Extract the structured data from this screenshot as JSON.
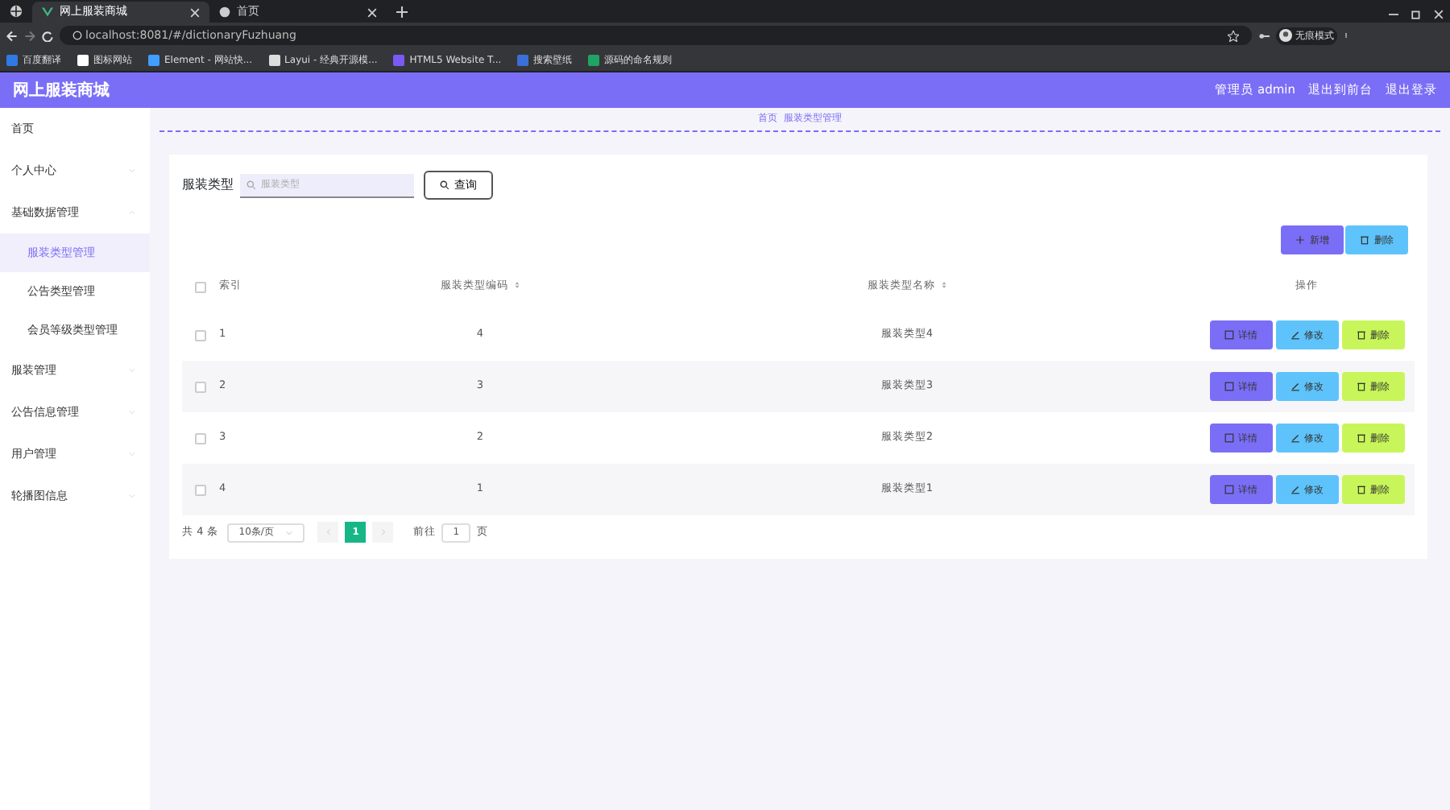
{
  "browser": {
    "tabs": [
      {
        "title": "网上服装商城",
        "selected": true
      },
      {
        "title": "首页",
        "selected": false
      }
    ],
    "address": "localhost:8081/#/dictionaryFuzhuang",
    "profile": "无痕模式",
    "bookmarks": [
      "百度翻译",
      "图标网站",
      "Element - 网站快...",
      "Layui - 经典开源模...",
      "HTML5 Website T...",
      "搜索壁纸",
      "源码的命名规则"
    ]
  },
  "header": {
    "title": "网上服装商城",
    "links": [
      "管理员 admin",
      "退出到前台",
      "退出登录"
    ]
  },
  "sidebar": {
    "items": [
      {
        "label": "首页"
      },
      {
        "label": "个人中心",
        "expanded": false
      },
      {
        "label": "基础数据管理",
        "expanded": true,
        "children": [
          {
            "label": "服装类型管理",
            "selected": true
          },
          {
            "label": "公告类型管理",
            "selected": false
          },
          {
            "label": "会员等级类型管理",
            "selected": false
          }
        ]
      },
      {
        "label": "服装管理",
        "expanded": false
      },
      {
        "label": "公告信息管理",
        "expanded": false
      },
      {
        "label": "用户管理",
        "expanded": false
      },
      {
        "label": "轮播图信息",
        "expanded": false
      }
    ]
  },
  "breadcrumb": [
    "首页",
    "服装类型管理"
  ],
  "search": {
    "label": "服装类型",
    "placeholder": "服装类型",
    "button": "查询"
  },
  "toolbar": [
    {
      "label": "新增",
      "kind": "add"
    },
    {
      "label": "删除",
      "kind": "delete"
    }
  ],
  "table": {
    "select_all_checked": false,
    "columns": [
      "索引",
      "服装类型编码",
      "服装类型名称",
      "操作"
    ],
    "rows": [
      {
        "index": "1",
        "code": "4",
        "name": "服装类型4",
        "checked": false,
        "actions": [
          {
            "label": "详情",
            "kind": "detail"
          },
          {
            "label": "修改",
            "kind": "edit"
          },
          {
            "label": "删除",
            "kind": "delete"
          }
        ]
      },
      {
        "index": "2",
        "code": "3",
        "name": "服装类型3",
        "checked": false,
        "actions": [
          {
            "label": "详情",
            "kind": "detail"
          },
          {
            "label": "修改",
            "kind": "edit"
          },
          {
            "label": "删除",
            "kind": "delete"
          }
        ]
      },
      {
        "index": "3",
        "code": "2",
        "name": "服装类型2",
        "checked": false,
        "actions": [
          {
            "label": "详情",
            "kind": "detail"
          },
          {
            "label": "修改",
            "kind": "edit"
          },
          {
            "label": "删除",
            "kind": "delete"
          }
        ]
      },
      {
        "index": "4",
        "code": "1",
        "name": "服装类型1",
        "checked": false,
        "actions": [
          {
            "label": "详情",
            "kind": "detail"
          },
          {
            "label": "修改",
            "kind": "edit"
          },
          {
            "label": "删除",
            "kind": "delete"
          }
        ]
      }
    ]
  },
  "pagination": {
    "total": "共 4 条",
    "page_size": "10条/页",
    "pages": [
      {
        "label": "1",
        "selected": true
      }
    ],
    "goto_label": "前往",
    "goto_value": "1",
    "goto_suffix": "页"
  }
}
